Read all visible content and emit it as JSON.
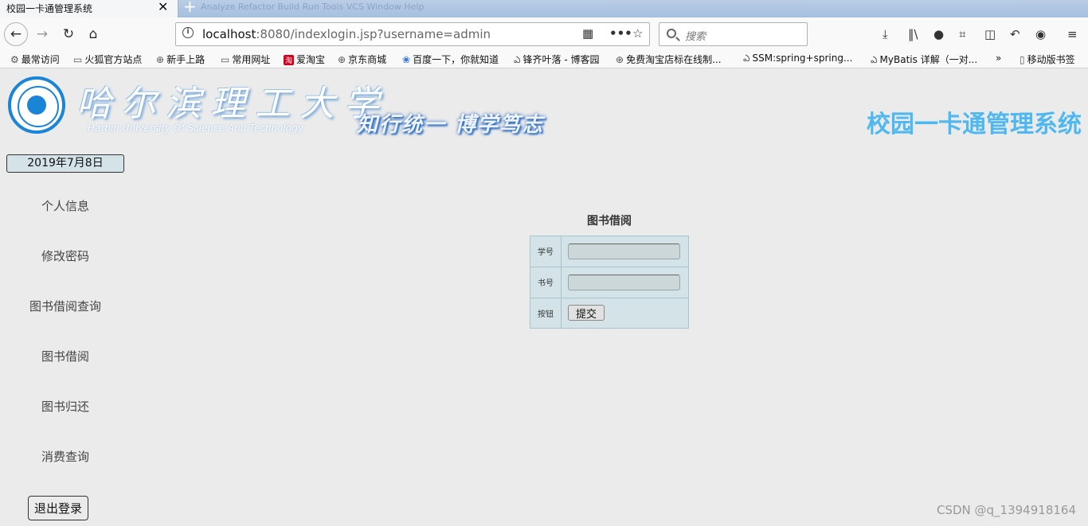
{
  "browser": {
    "tab_title": "校园一卡通管理系统",
    "tab_close": "✕",
    "new_tab": "+",
    "ghost_menu": "Analyze   Refactor   Build   Run   Tools   VCS   Window   Help",
    "url_host": "localhost",
    "url_rest": ":8080/indexlogin.jsp?username=admin",
    "search_placeholder": "搜索"
  },
  "bookmarks": [
    {
      "label": "最常访问",
      "icon": "⚙"
    },
    {
      "label": "火狐官方站点",
      "icon": "▭"
    },
    {
      "label": "新手上路",
      "icon": "⊕"
    },
    {
      "label": "常用网址",
      "icon": "▭"
    },
    {
      "label": "爱淘宝",
      "icon": "淘"
    },
    {
      "label": "京东商城",
      "icon": "⊕"
    },
    {
      "label": "百度一下，你就知道",
      "icon": "❀"
    },
    {
      "label": "锋齐叶落 - 博客园",
      "icon": "ఎ"
    },
    {
      "label": "免费淘宝店标在线制...",
      "icon": "⊕"
    },
    {
      "label": "SSM:spring+spring...",
      "icon": "ఎ"
    },
    {
      "label": "MyBatis 详解（一对...",
      "icon": "ఎ"
    },
    {
      "label": "移动版书签",
      "icon": "▯"
    }
  ],
  "header": {
    "university_cn": "哈尔滨理工大学",
    "university_en": "Harbin University Of Science And Technology",
    "motto": "知行统一   博学笃志",
    "system_title": "校园一卡通管理系统"
  },
  "sidebar": {
    "date": "2019年7月8日",
    "items": [
      {
        "label": "个人信息"
      },
      {
        "label": "修改密码"
      },
      {
        "label": "图书借阅查询"
      },
      {
        "label": "图书借阅"
      },
      {
        "label": "图书归还"
      },
      {
        "label": "消费查询"
      }
    ],
    "logout": "退出登录"
  },
  "form": {
    "title": "图书借阅",
    "student_label": "学号",
    "student_value": "",
    "book_label": "书号",
    "book_value": "",
    "button_label": "按钮",
    "submit": "提交"
  },
  "watermark": "CSDN @q_1394918164",
  "colors": {
    "system_title": "#4fb8f0",
    "table_bg": "#d3e3e7",
    "page_bg": "#ebebeb"
  }
}
